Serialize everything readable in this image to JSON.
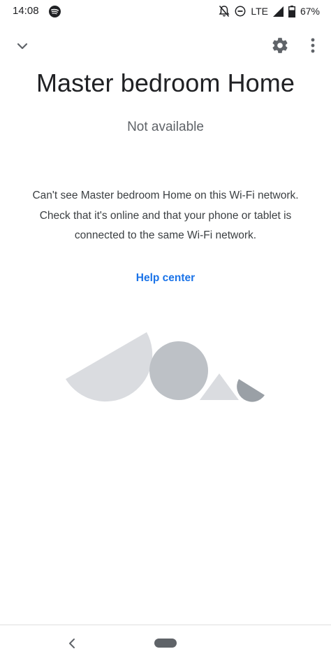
{
  "status_bar": {
    "time": "14:08",
    "network": "LTE",
    "battery": "67%",
    "icons": [
      "spotify-icon",
      "notifications-off-icon",
      "do-not-disturb-icon",
      "signal-icon",
      "battery-icon"
    ]
  },
  "toolbar": {
    "icons": [
      "chevron-down-icon",
      "gear-icon",
      "more-vert-icon"
    ]
  },
  "device": {
    "name": "Master bedroom Home",
    "status": "Not available"
  },
  "message": {
    "text": "Can't see Master bedroom Home on this Wi-Fi network. Check that it's online and that your phone or tablet is connected to the same Wi-Fi network."
  },
  "help_link": {
    "label": "Help center"
  },
  "illustration": {
    "colors": {
      "light": "#dadce0",
      "medium": "#bdc1c6",
      "dark": "#9aa0a6"
    }
  },
  "colors": {
    "accent": "#1a73e8",
    "text_primary": "#202124",
    "text_secondary": "#5f6368"
  },
  "nav_bar": {
    "icons": [
      "back-icon",
      "home-pill"
    ]
  }
}
